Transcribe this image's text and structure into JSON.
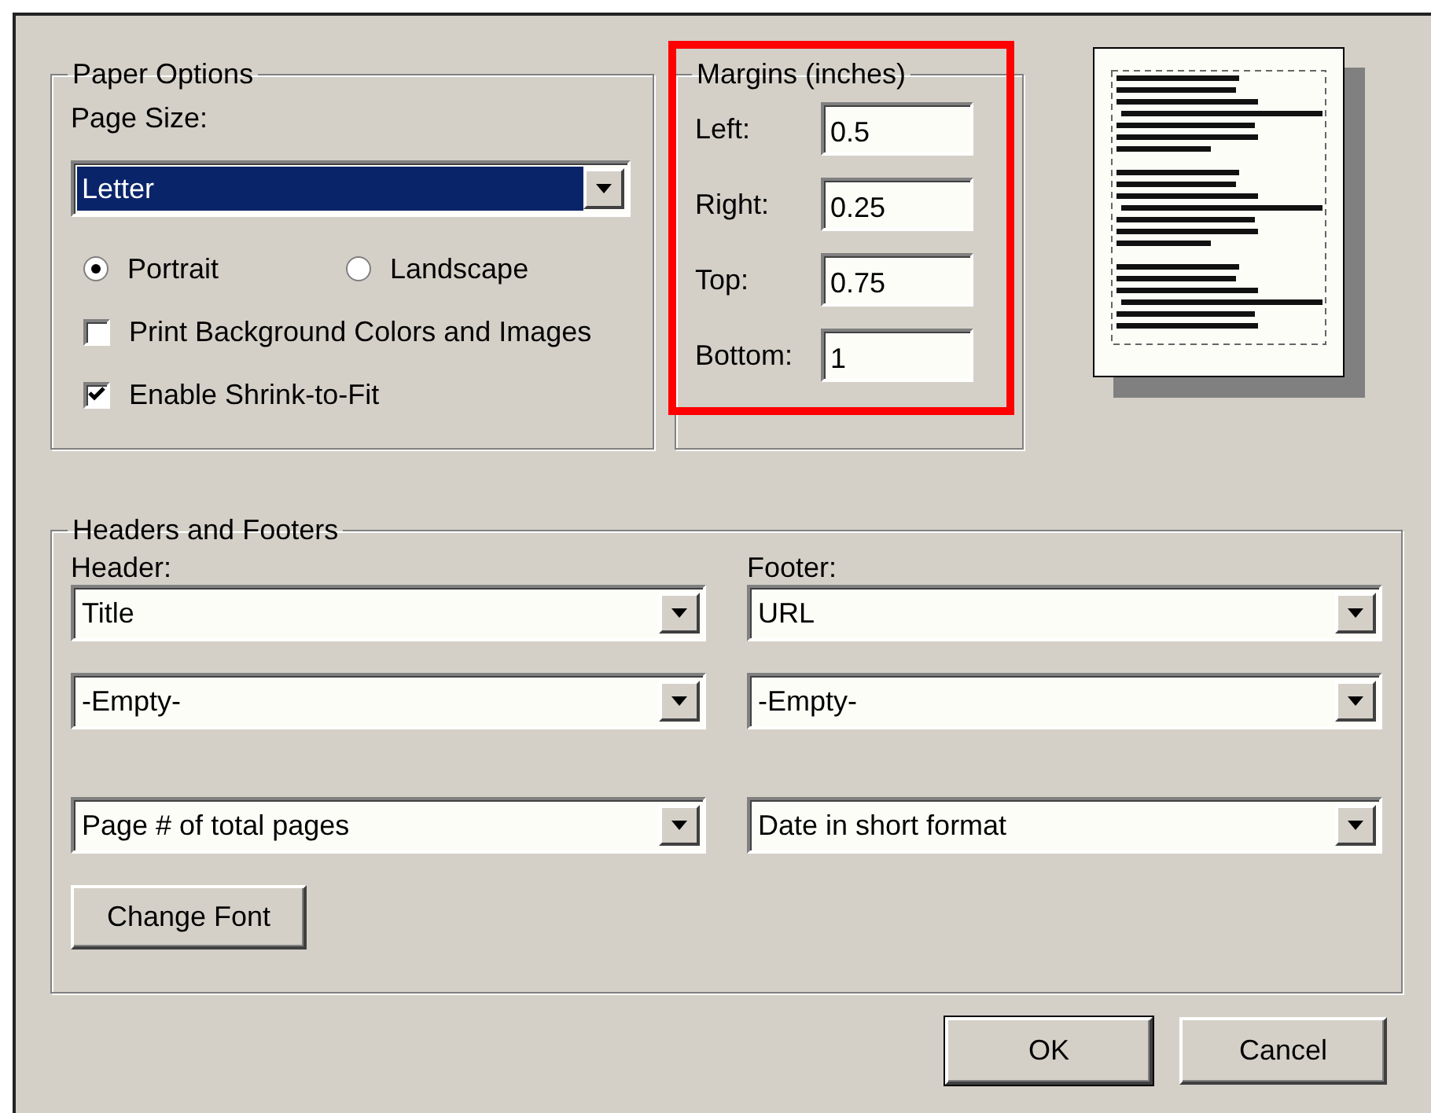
{
  "paper_options": {
    "title": "Paper Options",
    "page_size_label": "Page Size:",
    "page_size": {
      "value": "Letter",
      "highlighted": true
    },
    "orientation": [
      {
        "label": "Portrait",
        "selected": true
      },
      {
        "label": "Landscape",
        "selected": false
      }
    ],
    "options": [
      {
        "label": "Print Background Colors and Images",
        "checked": false
      },
      {
        "label": "Enable Shrink-to-Fit",
        "checked": true
      }
    ]
  },
  "margins": {
    "title": "Margins (inches)",
    "highlighted": true,
    "fields": [
      {
        "label": "Left:",
        "value": "0.5"
      },
      {
        "label": "Right:",
        "value": "0.25"
      },
      {
        "label": "Top:",
        "value": "0.75"
      },
      {
        "label": "Bottom:",
        "value": "1"
      }
    ]
  },
  "headers_footers": {
    "title": "Headers and Footers",
    "columns": [
      {
        "label": "Header:",
        "values": [
          "Title",
          "-Empty-",
          "Page # of total pages"
        ]
      },
      {
        "label": "Footer:",
        "values": [
          "URL",
          "-Empty-",
          "Date in short format"
        ]
      }
    ],
    "change_font_button": "Change Font"
  },
  "buttons": [
    {
      "label": "OK",
      "default": true
    },
    {
      "label": "Cancel",
      "default": false
    }
  ]
}
